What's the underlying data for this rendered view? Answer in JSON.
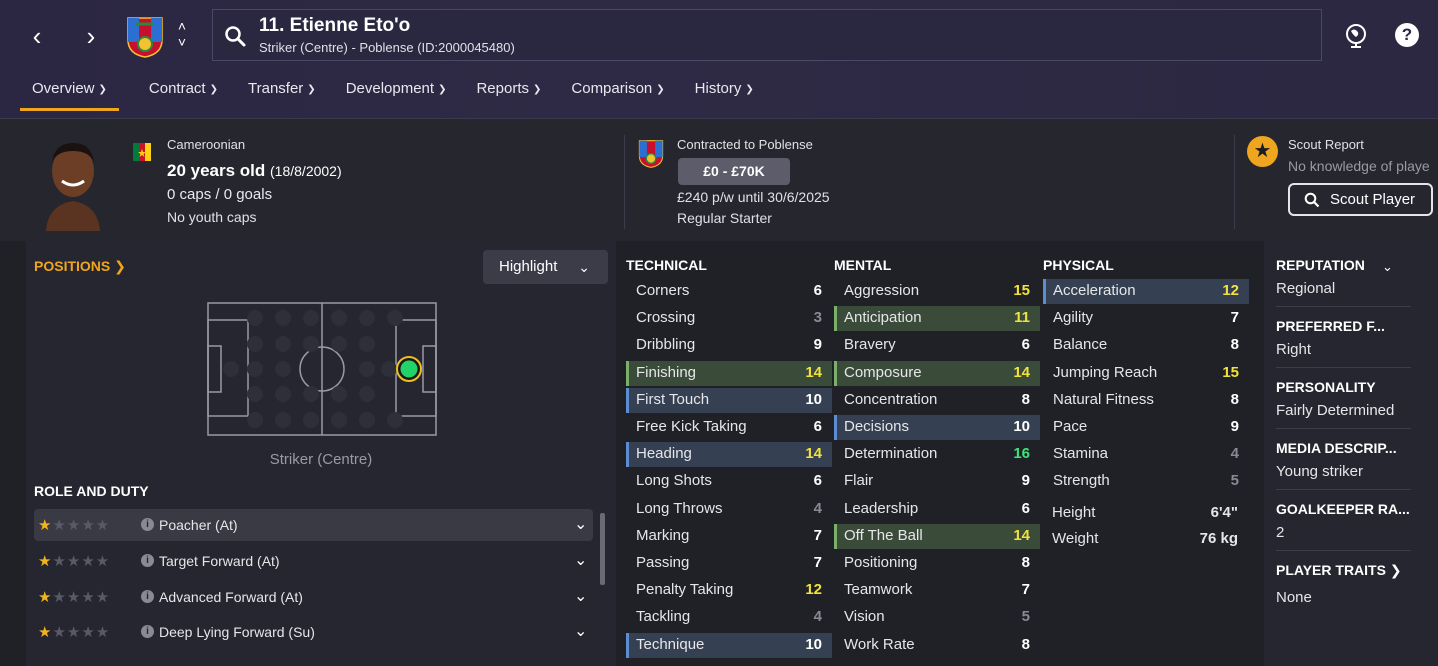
{
  "header": {
    "player_name": "11. Etienne Eto'o",
    "player_subtitle": "Striker (Centre) - Poblense (ID:2000045480)"
  },
  "tabs": [
    {
      "label": "Overview"
    },
    {
      "label": "Contract"
    },
    {
      "label": "Transfer"
    },
    {
      "label": "Development"
    },
    {
      "label": "Reports"
    },
    {
      "label": "Comparison"
    },
    {
      "label": "History"
    }
  ],
  "info": {
    "nationality": "Cameroonian",
    "age": "20 years old",
    "dob": "(18/8/2002)",
    "caps": "0 caps / 0 goals",
    "youth_caps": "No youth caps",
    "contract_label": "Contracted to Poblense",
    "value_range": "£0 - £70K",
    "wage": "£240 p/w until 30/6/2025",
    "squad_status": "Regular Starter",
    "scout_title": "Scout Report",
    "scout_text": "No knowledge of playe",
    "scout_button": "Scout Player"
  },
  "positions": {
    "title": "POSITIONS",
    "highlight_label": "Highlight",
    "caption": "Striker (Centre)"
  },
  "roles": {
    "title": "ROLE AND DUTY",
    "items": [
      {
        "name": "Poacher (At)",
        "stars": 1
      },
      {
        "name": "Target Forward (At)",
        "stars": 1
      },
      {
        "name": "Advanced Forward (At)",
        "stars": 1
      },
      {
        "name": "Deep Lying Forward (Su)",
        "stars": 1
      }
    ]
  },
  "technical": {
    "title": "TECHNICAL",
    "attrs": [
      {
        "name": "Corners",
        "value": "6"
      },
      {
        "name": "Crossing",
        "value": "3"
      },
      {
        "name": "Dribbling",
        "value": "9"
      },
      {
        "name": "Finishing",
        "value": "14"
      },
      {
        "name": "First Touch",
        "value": "10"
      },
      {
        "name": "Free Kick Taking",
        "value": "6"
      },
      {
        "name": "Heading",
        "value": "14"
      },
      {
        "name": "Long Shots",
        "value": "6"
      },
      {
        "name": "Long Throws",
        "value": "4"
      },
      {
        "name": "Marking",
        "value": "7"
      },
      {
        "name": "Passing",
        "value": "7"
      },
      {
        "name": "Penalty Taking",
        "value": "12"
      },
      {
        "name": "Tackling",
        "value": "4"
      },
      {
        "name": "Technique",
        "value": "10"
      }
    ]
  },
  "mental": {
    "title": "MENTAL",
    "attrs": [
      {
        "name": "Aggression",
        "value": "15"
      },
      {
        "name": "Anticipation",
        "value": "11"
      },
      {
        "name": "Bravery",
        "value": "6"
      },
      {
        "name": "Composure",
        "value": "14"
      },
      {
        "name": "Concentration",
        "value": "8"
      },
      {
        "name": "Decisions",
        "value": "10"
      },
      {
        "name": "Determination",
        "value": "16"
      },
      {
        "name": "Flair",
        "value": "9"
      },
      {
        "name": "Leadership",
        "value": "6"
      },
      {
        "name": "Off The Ball",
        "value": "14"
      },
      {
        "name": "Positioning",
        "value": "8"
      },
      {
        "name": "Teamwork",
        "value": "7"
      },
      {
        "name": "Vision",
        "value": "5"
      },
      {
        "name": "Work Rate",
        "value": "8"
      }
    ]
  },
  "physical": {
    "title": "PHYSICAL",
    "attrs": [
      {
        "name": "Acceleration",
        "value": "12"
      },
      {
        "name": "Agility",
        "value": "7"
      },
      {
        "name": "Balance",
        "value": "8"
      },
      {
        "name": "Jumping Reach",
        "value": "15"
      },
      {
        "name": "Natural Fitness",
        "value": "8"
      },
      {
        "name": "Pace",
        "value": "9"
      },
      {
        "name": "Stamina",
        "value": "4"
      },
      {
        "name": "Strength",
        "value": "5"
      }
    ],
    "height_label": "Height",
    "height": "6'4\"",
    "weight_label": "Weight",
    "weight": "76 kg"
  },
  "sidebar": {
    "reputation_title": "REPUTATION",
    "reputation": "Regional",
    "foot_title": "PREFERRED F...",
    "foot": "Right",
    "personality_title": "PERSONALITY",
    "personality": "Fairly Determined",
    "media_title": "MEDIA DESCRIP...",
    "media": "Young striker",
    "gk_title": "GOALKEEPER RA...",
    "gk": "2",
    "traits_title": "PLAYER TRAITS",
    "traits": "None"
  },
  "colors": {
    "accent": "#f0a51e",
    "value_yellow": "#f2e23c",
    "value_green": "#3ee37a",
    "highlight_blue": "#354152",
    "highlight_green": "#3a4b3a"
  }
}
